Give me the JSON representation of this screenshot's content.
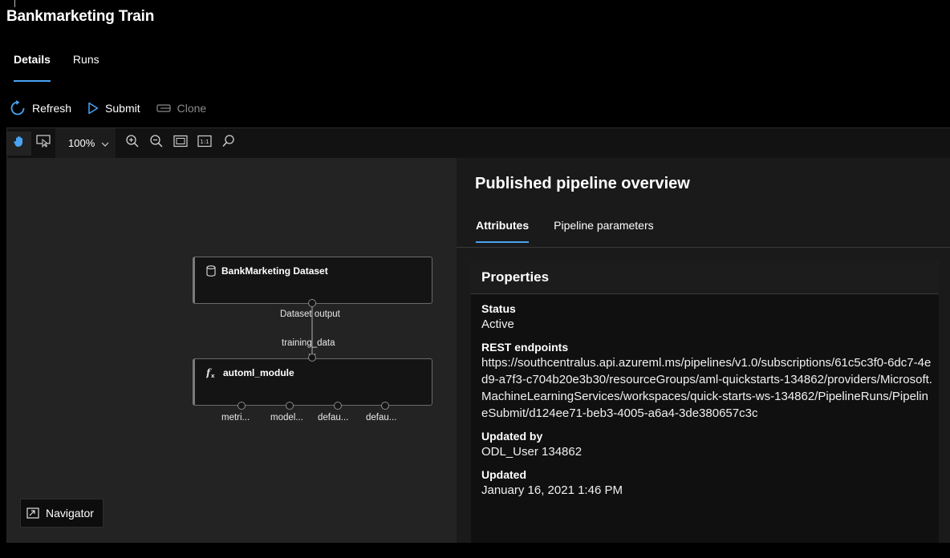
{
  "page": {
    "title": "Bankmarketing Train"
  },
  "tabs": [
    {
      "label": "Details",
      "active": true
    },
    {
      "label": "Runs",
      "active": false
    }
  ],
  "commands": {
    "refresh": "Refresh",
    "submit": "Submit",
    "clone": "Clone"
  },
  "canvas_toolbar": {
    "zoom": "100%",
    "buttons": [
      "pan-hand-icon",
      "select-pointer-icon",
      "zoom-in-icon",
      "zoom-out-icon",
      "fit-to-screen-icon",
      "actual-size-icon",
      "search-icon"
    ]
  },
  "graph": {
    "dataset_module": {
      "title": "BankMarketing Dataset",
      "icon": "database-icon",
      "output_port": "Dataset output"
    },
    "automl_module": {
      "title": "automl_module",
      "icon": "function-icon",
      "input_port": "training_data",
      "output_ports": [
        "metri...",
        "model...",
        "defau...",
        "defau..."
      ]
    },
    "navigator": "Navigator"
  },
  "panel": {
    "title": "Published pipeline overview",
    "tabs": [
      {
        "label": "Attributes",
        "active": true
      },
      {
        "label": "Pipeline parameters",
        "active": false
      }
    ],
    "properties": {
      "heading": "Properties",
      "status_label": "Status",
      "status_value": "Active",
      "rest_label": "REST endpoints",
      "rest_value": "https://southcentralus.api.azureml.ms/pipelines/v1.0/subscriptions/61c5c3f0-6dc7-4ed9-a7f3-c704b20e3b30/resourceGroups/aml-quickstarts-134862/providers/Microsoft.MachineLearningServices/workspaces/quick-starts-ws-134862/PipelineRuns/PipelineSubmit/d124ee71-beb3-4005-a6a4-3de380657c3c",
      "updated_by_label": "Updated by",
      "updated_by_value": "ODL_User 134862",
      "updated_label": "Updated",
      "updated_value": "January 16, 2021 1:46 PM"
    }
  },
  "colors": {
    "accent": "#4aa3f2",
    "canvas_bg": "#232323",
    "panel_bg": "#1a1a1a"
  }
}
